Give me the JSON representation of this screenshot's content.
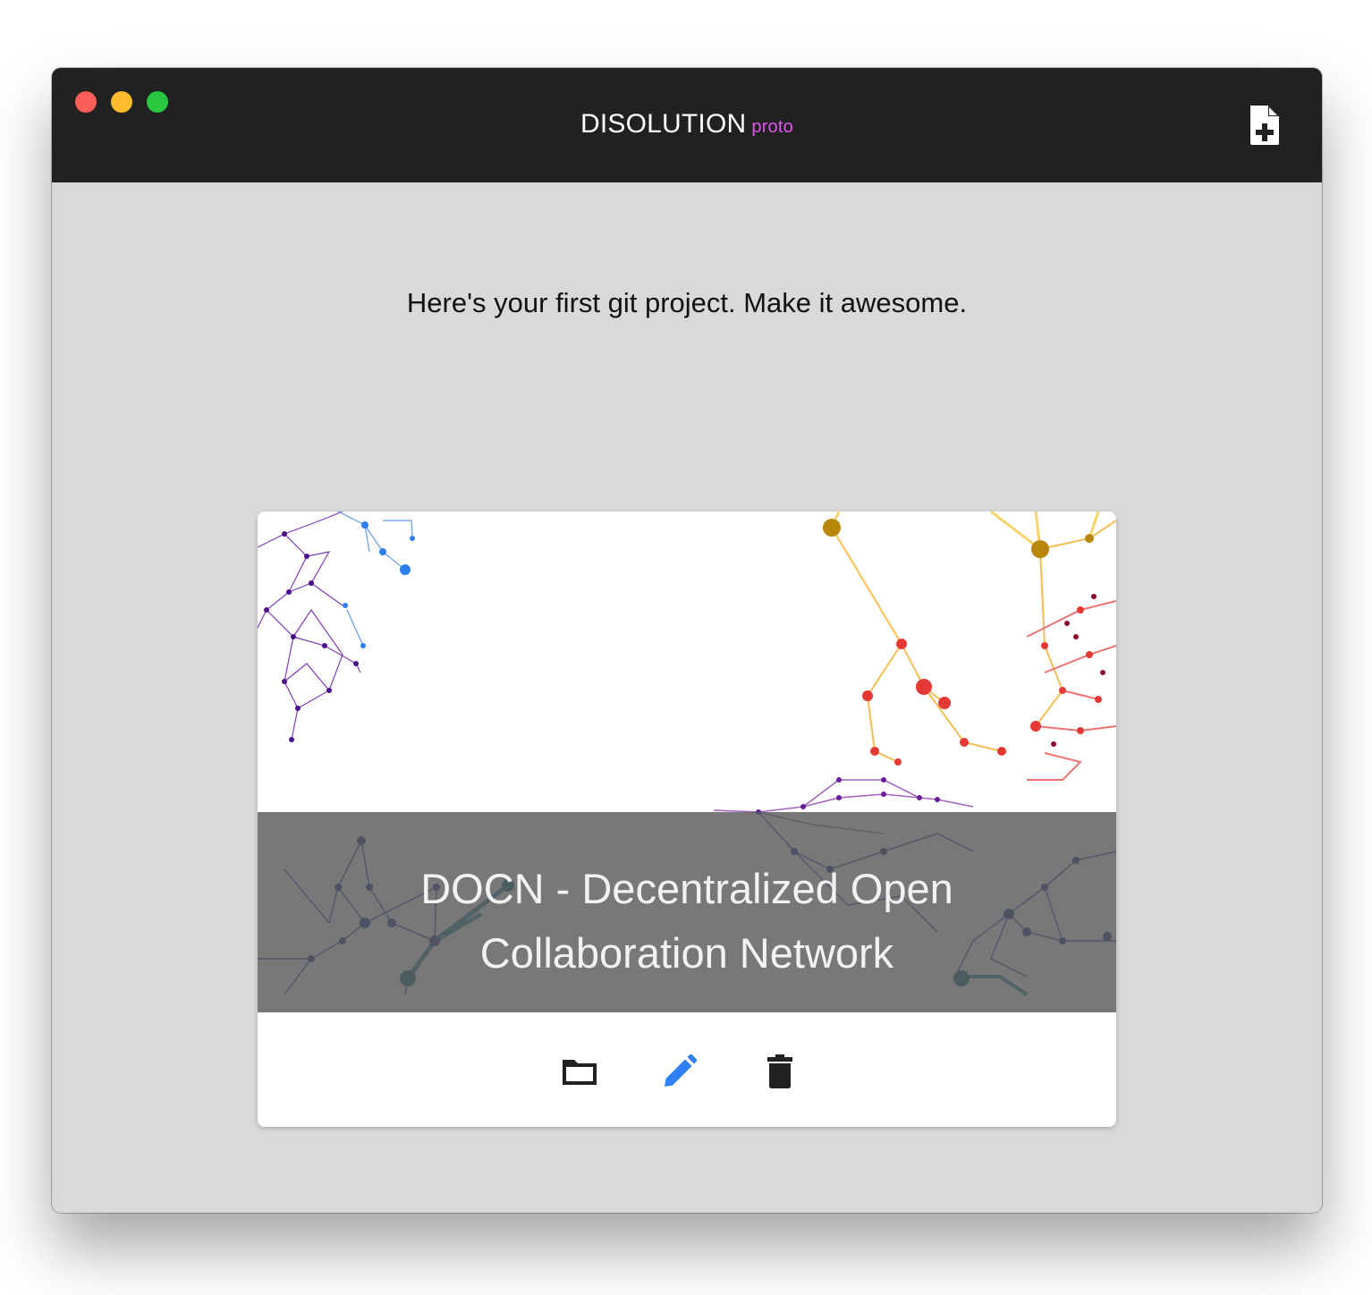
{
  "window": {
    "app_name": "DISOLUTION",
    "app_tag": "proto",
    "new_button_icon": "new-file-icon"
  },
  "main": {
    "welcome_text": "Here's your first git project. Make it awesome."
  },
  "project_card": {
    "title_line1": "DOCN - Decentralized Open",
    "title_line2": "Collaboration Network",
    "actions": [
      {
        "icon": "folder-icon",
        "color": "#212121"
      },
      {
        "icon": "pencil-icon",
        "color": "#2f7ff5"
      },
      {
        "icon": "trash-icon",
        "color": "#212121"
      }
    ]
  },
  "colors": {
    "titlebar": "#212121",
    "background": "#d9d9d9",
    "tag": "#e056ee",
    "accent": "#2f7ff5"
  }
}
